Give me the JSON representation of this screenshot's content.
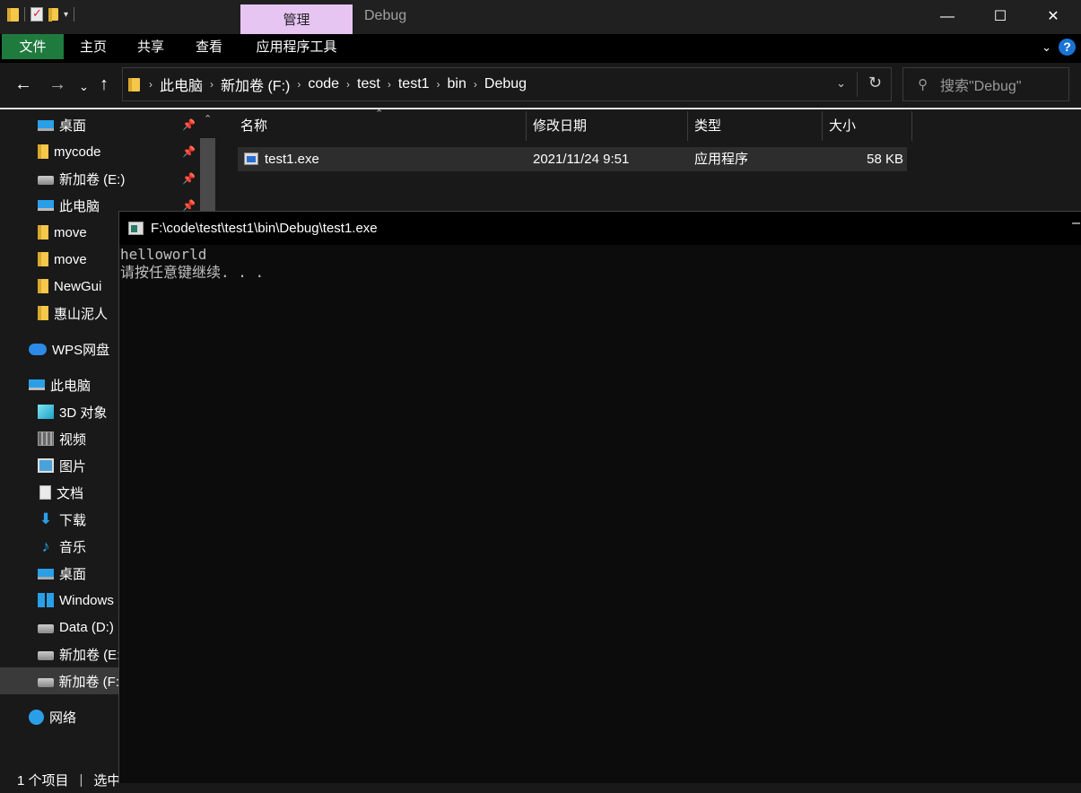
{
  "title_bar": {
    "manage_tab": "管理",
    "window_title": "Debug",
    "minimize": "—",
    "maximize": "☐",
    "close": "✕"
  },
  "ribbon": {
    "tabs": [
      "文件",
      "主页",
      "共享",
      "查看",
      "应用程序工具"
    ],
    "expand_glyph": "⌄",
    "help_glyph": "?"
  },
  "nav": {
    "back": "←",
    "forward": "→",
    "recent": "⌄",
    "up": "↑",
    "breadcrumb": [
      "此电脑",
      "新加卷 (F:)",
      "code",
      "test",
      "test1",
      "bin",
      "Debug"
    ],
    "crumb_sep": "›",
    "refresh": "↻",
    "search_placeholder": "搜索\"Debug\""
  },
  "sidebar": {
    "items": [
      {
        "label": "桌面",
        "icon": "desktop-icon",
        "pinned": true
      },
      {
        "label": "mycode",
        "icon": "folder-icon",
        "pinned": true
      },
      {
        "label": "新加卷 (E:)",
        "icon": "drive-icon",
        "pinned": true
      },
      {
        "label": "此电脑",
        "icon": "computer-icon",
        "pinned": true
      },
      {
        "label": "move",
        "icon": "folder-icon"
      },
      {
        "label": "move",
        "icon": "folder-icon"
      },
      {
        "label": "NewGui",
        "icon": "folder-icon"
      },
      {
        "label": "惠山泥人",
        "icon": "folder-icon"
      },
      {
        "label": "WPS网盘",
        "icon": "cloud-icon"
      },
      {
        "label": "此电脑",
        "icon": "computer-icon"
      },
      {
        "label": "3D 对象",
        "icon": "3d-objects-icon"
      },
      {
        "label": "视频",
        "icon": "video-icon"
      },
      {
        "label": "图片",
        "icon": "pictures-icon"
      },
      {
        "label": "文档",
        "icon": "documents-icon"
      },
      {
        "label": "下载",
        "icon": "download-icon"
      },
      {
        "label": "音乐",
        "icon": "music-icon"
      },
      {
        "label": "桌面",
        "icon": "desktop-icon"
      },
      {
        "label": "Windows",
        "icon": "windows-drive-icon"
      },
      {
        "label": "Data (D:)",
        "icon": "drive-icon"
      },
      {
        "label": "新加卷 (E:",
        "icon": "drive-icon"
      },
      {
        "label": "新加卷 (F:",
        "icon": "drive-icon",
        "selected": true
      },
      {
        "label": "网络",
        "icon": "network-icon"
      }
    ]
  },
  "file_list": {
    "columns": [
      "名称",
      "修改日期",
      "类型",
      "大小"
    ],
    "rows": [
      {
        "name": "test1.exe",
        "modified": "2021/11/24 9:51",
        "type": "应用程序",
        "size": "58 KB"
      }
    ]
  },
  "status": {
    "item_count": "1 个项目",
    "selected": "选中"
  },
  "console": {
    "title": "F:\\code\\test\\test1\\bin\\Debug\\test1.exe",
    "lines": [
      "helloworld",
      "请按任意键继续. . ."
    ],
    "minimize": "–"
  }
}
